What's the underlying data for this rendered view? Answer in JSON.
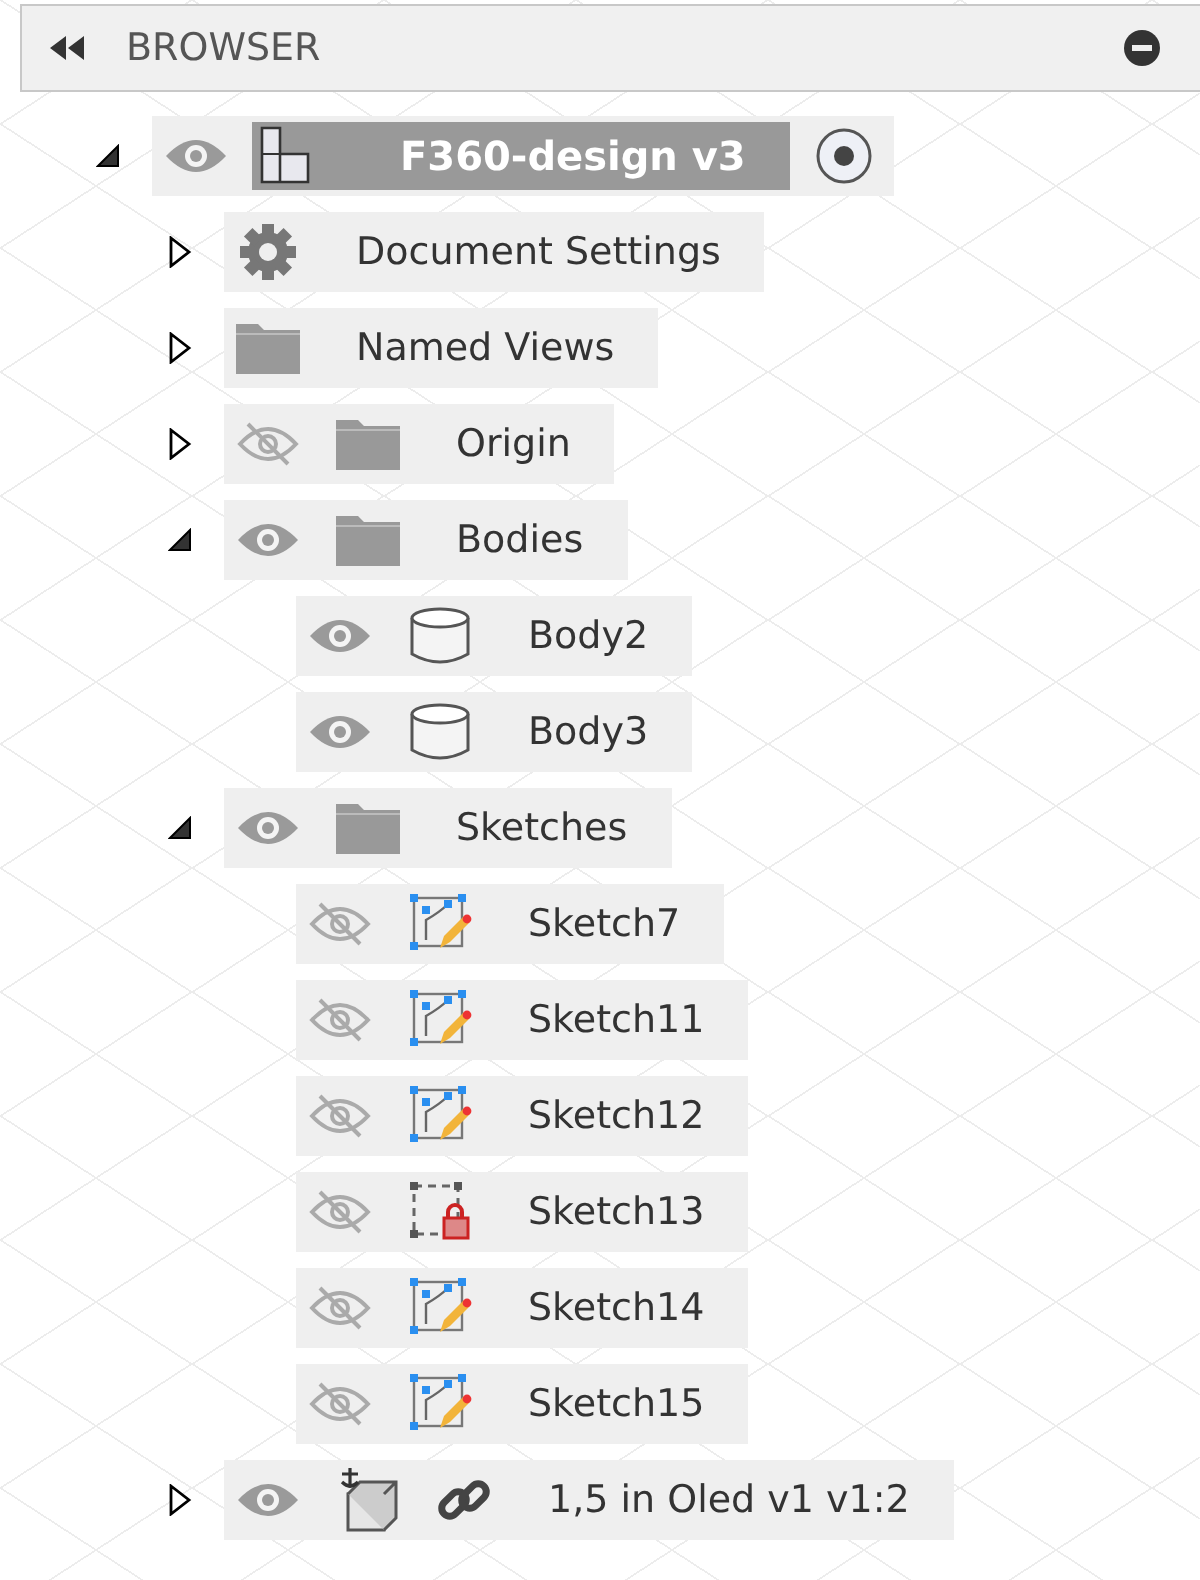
{
  "panel": {
    "title": "BROWSER"
  },
  "root": {
    "name": "F360-design v3",
    "visible": true,
    "expanded": true,
    "active": true,
    "selected": true,
    "children": [
      {
        "name": "Document Settings",
        "kind": "settings",
        "expanded": false
      },
      {
        "name": "Named Views",
        "kind": "folder",
        "expanded": false
      },
      {
        "name": "Origin",
        "kind": "folder",
        "visible": false,
        "expanded": false
      },
      {
        "name": "Bodies",
        "kind": "folder",
        "visible": true,
        "expanded": true,
        "children": [
          {
            "name": "Body2",
            "kind": "body",
            "visible": true
          },
          {
            "name": "Body3",
            "kind": "body",
            "visible": true
          }
        ]
      },
      {
        "name": "Sketches",
        "kind": "folder",
        "visible": true,
        "expanded": true,
        "children": [
          {
            "name": "Sketch7",
            "kind": "sketch",
            "visible": false
          },
          {
            "name": "Sketch11",
            "kind": "sketch",
            "visible": false
          },
          {
            "name": "Sketch12",
            "kind": "sketch",
            "visible": false
          },
          {
            "name": "Sketch13",
            "kind": "locked-sketch",
            "visible": false
          },
          {
            "name": "Sketch14",
            "kind": "sketch",
            "visible": false
          },
          {
            "name": "Sketch15",
            "kind": "sketch",
            "visible": false
          }
        ]
      },
      {
        "name": "1,5 in Oled v1 v1:2",
        "kind": "linked-component",
        "visible": true,
        "expanded": false
      }
    ]
  }
}
